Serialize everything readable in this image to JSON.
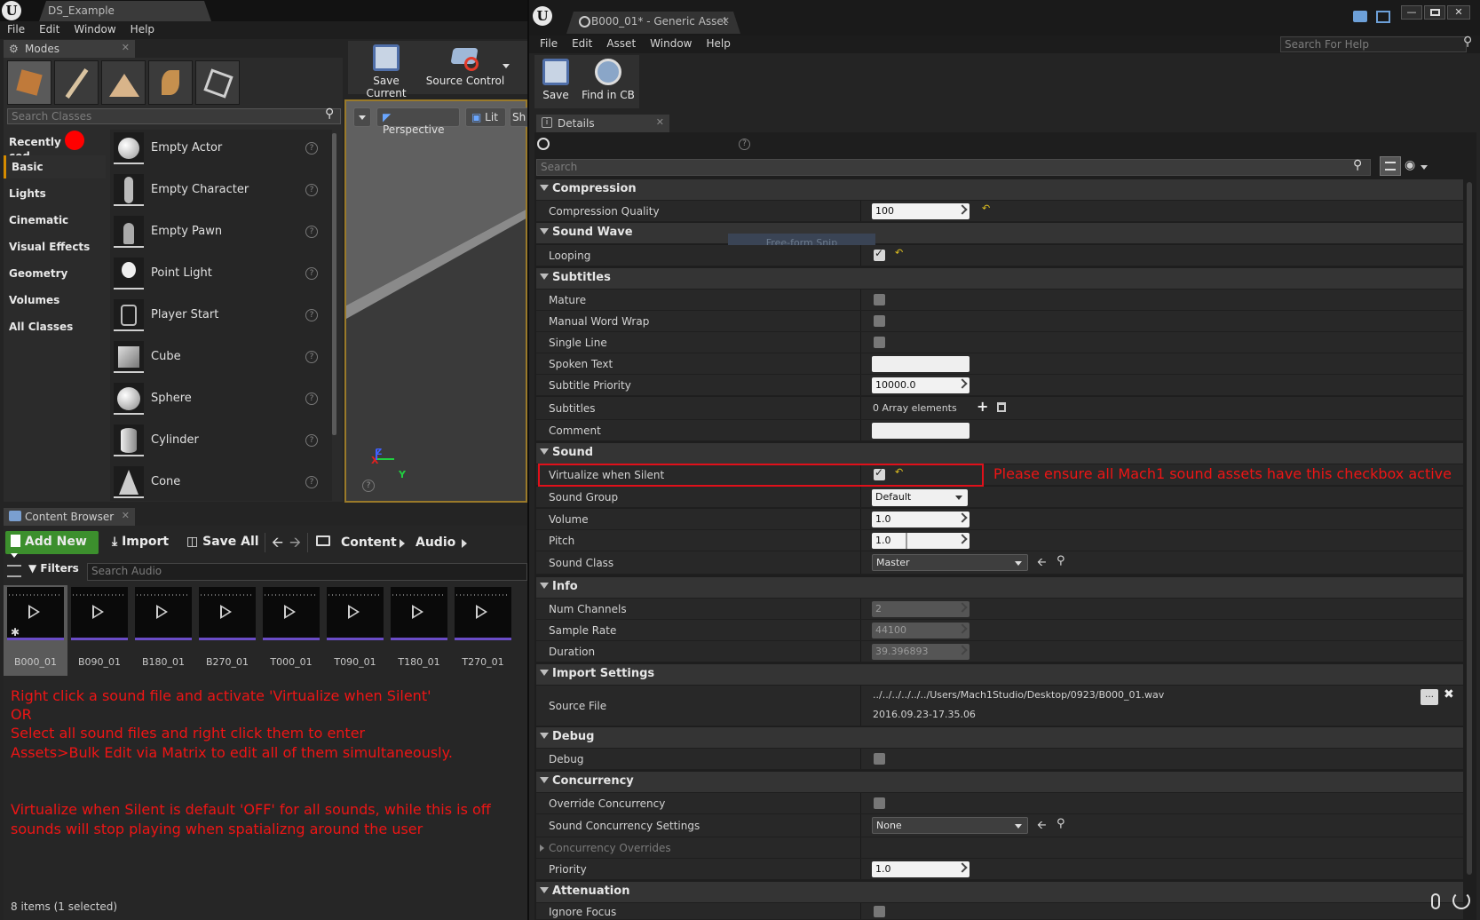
{
  "left_editor": {
    "window_tab": "DS_Example",
    "menu": [
      "File",
      "Edit",
      "Window",
      "Help"
    ],
    "modes_tab": "Modes",
    "search_classes_placeholder": "Search Classes",
    "categories": [
      "Recently",
      "ced",
      "Basic",
      "Lights",
      "Cinematic",
      "Visual Effects",
      "Geometry",
      "Volumes",
      "All Classes"
    ],
    "actors": [
      "Empty Actor",
      "Empty Character",
      "Empty Pawn",
      "Point Light",
      "Player Start",
      "Cube",
      "Sphere",
      "Cylinder",
      "Cone"
    ],
    "toolbar": {
      "save_current": "Save Current",
      "source_control": "Source Control"
    },
    "viewport": {
      "perspective": "Perspective",
      "lit": "Lit",
      "show": "Sh",
      "axis_x": "X",
      "axis_y": "Y",
      "axis_z": "Z"
    },
    "content_browser": {
      "tab": "Content Browser",
      "add_new": "Add New",
      "import": "Import",
      "save_all": "Save All",
      "path": [
        "Content",
        "Audio"
      ],
      "filters": "Filters",
      "search_placeholder": "Search Audio",
      "assets": [
        "B000_01",
        "B090_01",
        "B180_01",
        "B270_01",
        "T000_01",
        "T090_01",
        "T180_01",
        "T270_01"
      ],
      "status": "8 items (1 selected)"
    },
    "notes": [
      "Right click a sound file and activate 'Virtualize when Silent'",
      "OR",
      "Select all sound files and right click them to enter",
      "Assets>Bulk Edit via Matrix to edit all of them simultaneously.",
      "Virtualize when Silent is default 'OFF' for all sounds, while this is off",
      "sounds will stop playing when spatializng around the user"
    ]
  },
  "right_editor": {
    "window_tab": "B000_01* - Generic Asset",
    "menu": [
      "File",
      "Edit",
      "Asset",
      "Window",
      "Help"
    ],
    "search_help_placeholder": "Search For Help",
    "toolbar": {
      "save": "Save",
      "find_in_cb": "Find in CB"
    },
    "details_tab": "Details",
    "search_placeholder": "Search",
    "snip_overlay": "Free-form Snip",
    "annotation": "Please ensure all Mach1 sound assets have this checkbox active",
    "sections": {
      "compression": {
        "title": "Compression",
        "quality_label": "Compression Quality",
        "quality_value": "100"
      },
      "sound_wave": {
        "title": "Sound Wave",
        "looping_label": "Looping",
        "looping": true
      },
      "subtitles": {
        "title": "Subtitles",
        "mature_label": "Mature",
        "manual_wrap_label": "Manual Word Wrap",
        "single_line_label": "Single Line",
        "spoken_text_label": "Spoken Text",
        "priority_label": "Subtitle Priority",
        "priority_value": "10000.0",
        "subtitles_label": "Subtitles",
        "subtitles_value": "0 Array elements",
        "comment_label": "Comment"
      },
      "sound": {
        "title": "Sound",
        "virtualize_label": "Virtualize when Silent",
        "virtualize": true,
        "group_label": "Sound Group",
        "group_value": "Default",
        "volume_label": "Volume",
        "volume_value": "1.0",
        "pitch_label": "Pitch",
        "pitch_value": "1.0",
        "class_label": "Sound Class",
        "class_value": "Master"
      },
      "info": {
        "title": "Info",
        "channels_label": "Num Channels",
        "channels_value": "2",
        "rate_label": "Sample Rate",
        "rate_value": "44100",
        "duration_label": "Duration",
        "duration_value": "39.396893"
      },
      "import_settings": {
        "title": "Import Settings",
        "source_label": "Source File",
        "source_path": "../../../../../../Users/Mach1Studio/Desktop/0923/B000_01.wav",
        "source_time": "2016.09.23-17.35.06"
      },
      "debug": {
        "title": "Debug",
        "debug_label": "Debug"
      },
      "concurrency": {
        "title": "Concurrency",
        "override_label": "Override Concurrency",
        "settings_label": "Sound Concurrency Settings",
        "settings_value": "None",
        "overrides_label": "Concurrency Overrides",
        "priority_label": "Priority",
        "priority_value": "1.0"
      },
      "attenuation": {
        "title": "Attenuation",
        "ignore_focus_label": "Ignore Focus"
      }
    }
  },
  "colors": {
    "accent_orange": "#d58b00",
    "annotation_red": "#ee1515",
    "add_new_green": "#3c8f2d",
    "asset_purple": "#6a4cc6"
  }
}
